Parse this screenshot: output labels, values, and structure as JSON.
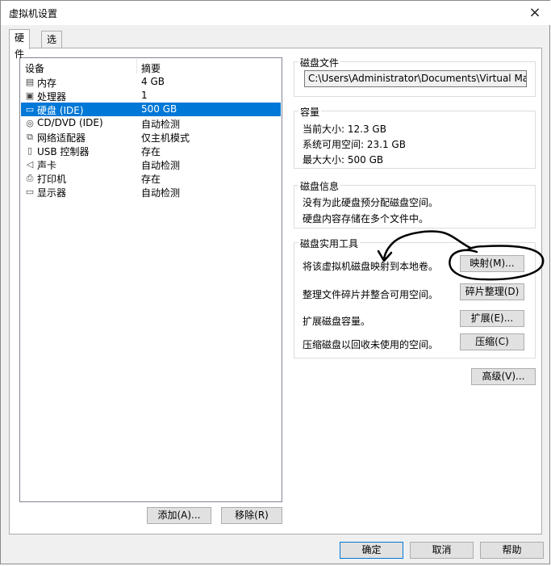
{
  "window": {
    "title": "虚拟机设置",
    "close": "×"
  },
  "tabs": [
    {
      "label": "硬件"
    },
    {
      "label": "选项"
    }
  ],
  "device_list": {
    "headers": {
      "device": "设备",
      "summary": "摘要"
    },
    "rows": [
      {
        "name": "内存",
        "summary": "4 GB",
        "icon": "memory-icon",
        "glyph": "▤"
      },
      {
        "name": "处理器",
        "summary": "1",
        "icon": "processor-icon",
        "glyph": "▣"
      },
      {
        "name": "硬盘 (IDE)",
        "summary": "500 GB",
        "icon": "hard-disk-icon",
        "glyph": "▭",
        "selected": true
      },
      {
        "name": "CD/DVD (IDE)",
        "summary": "自动检测",
        "icon": "cd-dvd-icon",
        "glyph": "◎"
      },
      {
        "name": "网络适配器",
        "summary": "仅主机模式",
        "icon": "network-adapter-icon",
        "glyph": "⧉"
      },
      {
        "name": "USB 控制器",
        "summary": "存在",
        "icon": "usb-controller-icon",
        "glyph": "▯"
      },
      {
        "name": "声卡",
        "summary": "自动检测",
        "icon": "sound-card-icon",
        "glyph": "◁"
      },
      {
        "name": "打印机",
        "summary": "存在",
        "icon": "printer-icon",
        "glyph": "⎙"
      },
      {
        "name": "显示器",
        "summary": "自动检测",
        "icon": "display-icon",
        "glyph": "▭"
      }
    ]
  },
  "list_buttons": {
    "add": "添加(A)...",
    "remove": "移除(R)"
  },
  "disk_file": {
    "title": "磁盘文件",
    "path": "C:\\Users\\Administrator\\Documents\\Virtual Machines\\"
  },
  "capacity": {
    "title": "容量",
    "current": "当前大小: 12.3 GB",
    "available": "系统可用空间: 23.1 GB",
    "max": "最大大小: 500 GB"
  },
  "disk_info": {
    "title": "磁盘信息",
    "line1": "没有为此硬盘预分配磁盘空间。",
    "line2": "硬盘内容存储在多个文件中。"
  },
  "disk_utilities": {
    "title": "磁盘实用工具",
    "map_desc": "将该虚拟机磁盘映射到本地卷。",
    "map_btn": "映射(M)...",
    "defrag_desc": "整理文件碎片并整合可用空间。",
    "defrag_btn": "碎片整理(D)",
    "expand_desc": "扩展磁盘容量。",
    "expand_btn": "扩展(E)...",
    "compact_desc": "压缩磁盘以回收未使用的空间。",
    "compact_btn": "压缩(C)"
  },
  "advanced_btn": "高级(V)...",
  "footer": {
    "ok": "确定",
    "cancel": "取消",
    "help": "帮助"
  }
}
